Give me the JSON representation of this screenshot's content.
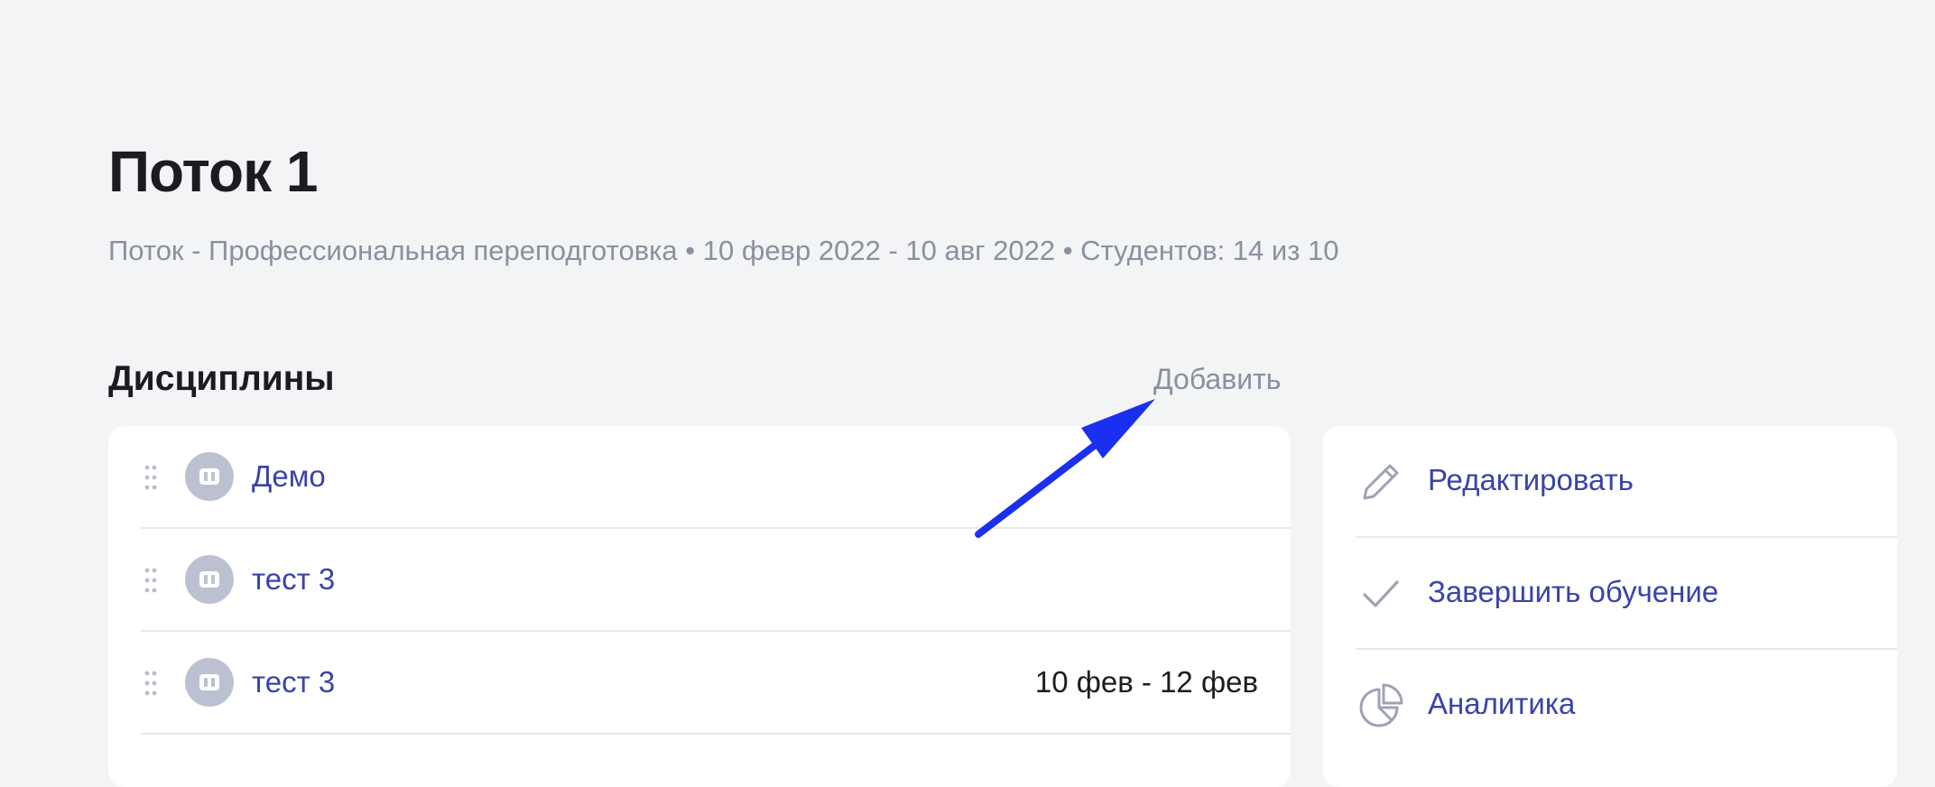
{
  "header": {
    "title": "Поток 1",
    "subtitle": "Поток - Профессиональная переподготовка • 10 февр 2022 - 10 авг 2022 • Студентов: 14 из 10"
  },
  "disciplines": {
    "section_title": "Дисциплины",
    "add_label": "Добавить",
    "items": [
      {
        "name": "Демо",
        "dates": ""
      },
      {
        "name": "тест 3",
        "dates": ""
      },
      {
        "name": "тест 3",
        "dates": "10 фев - 12 фев"
      }
    ]
  },
  "actions": {
    "items": [
      {
        "label": "Редактировать",
        "icon": "pencil-icon"
      },
      {
        "label": "Завершить обучение",
        "icon": "checkmark-icon"
      },
      {
        "label": "Аналитика",
        "icon": "pie-chart-icon"
      }
    ]
  },
  "colors": {
    "background": "#f3f4f6",
    "link": "#3a43a8",
    "muted": "#8b8f9e",
    "annotation_arrow": "#1a2ff0"
  }
}
